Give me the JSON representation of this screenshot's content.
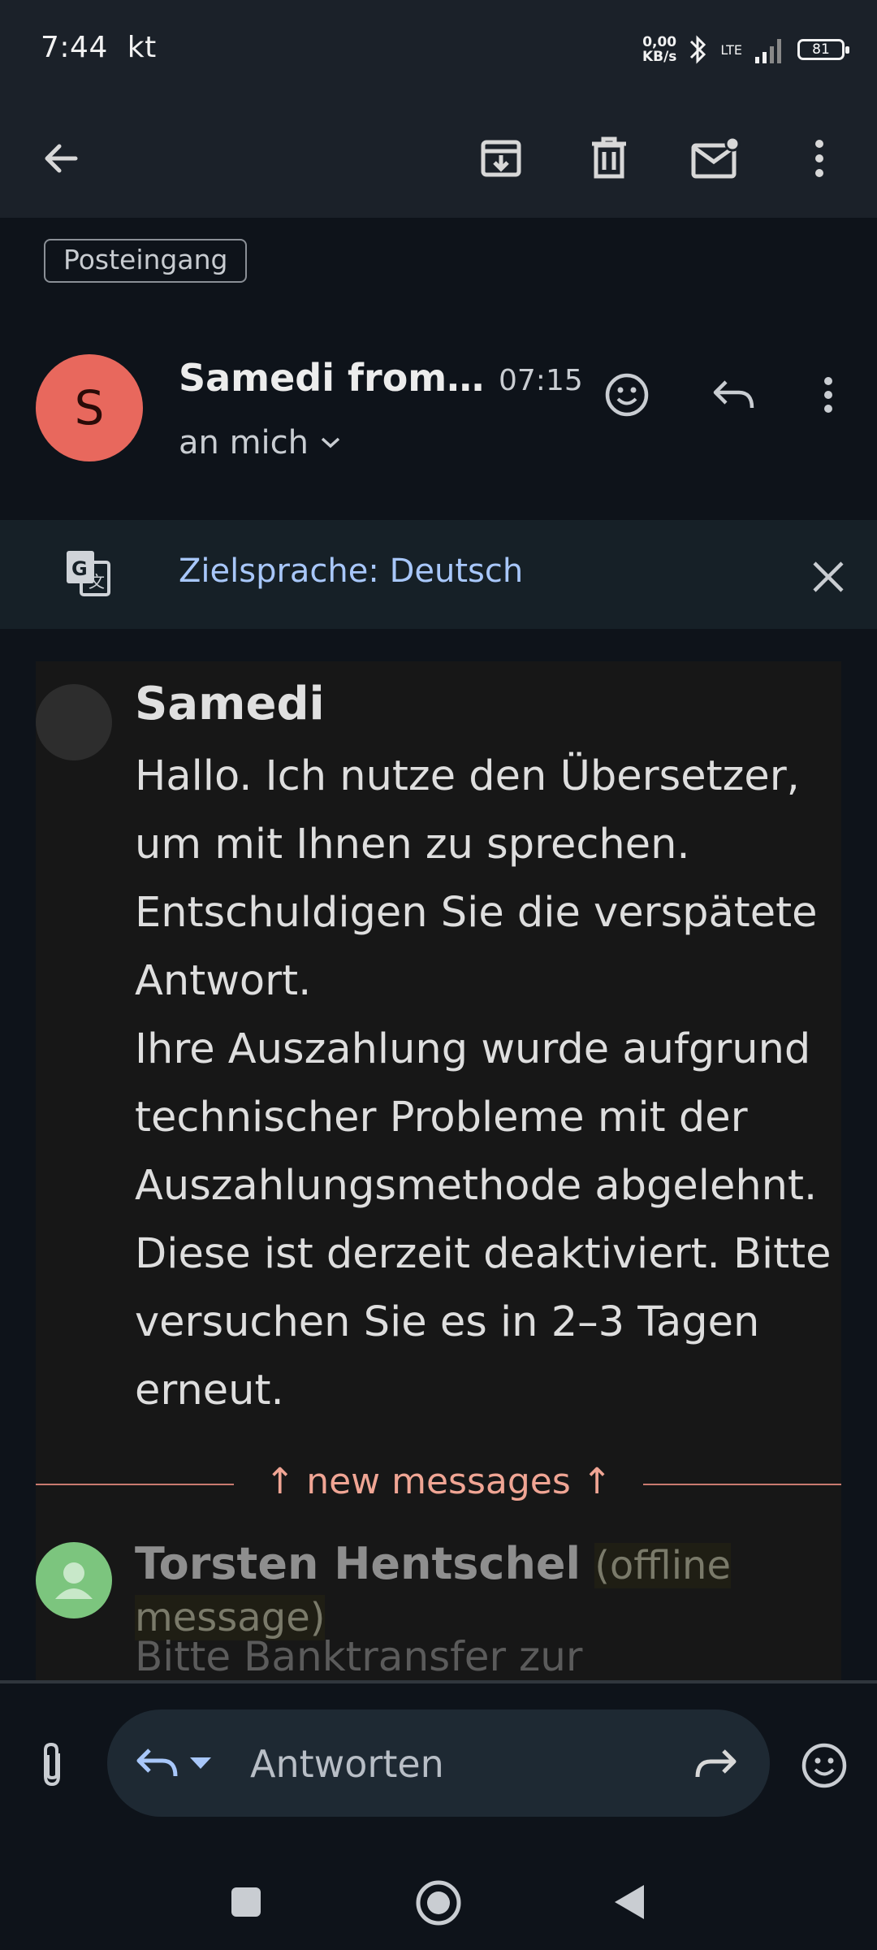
{
  "status_bar": {
    "time": "7:44",
    "carrier": "kt",
    "net_speed_value": "0,00",
    "net_speed_unit": "KB/s",
    "network": "LTE",
    "battery": "81"
  },
  "toolbar": {
    "icons": [
      "back-arrow-icon",
      "archive-icon",
      "delete-icon",
      "mark-unread-icon",
      "more-vert-icon"
    ]
  },
  "label": "Posteingang",
  "email": {
    "sender_initial": "S",
    "sender_name": "Samedi from…",
    "time": "07:15",
    "recipient": "an mich"
  },
  "translate_bar": {
    "text": "Zielsprache: Deutsch"
  },
  "message": {
    "sender": "Samedi",
    "body_lines": [
      "Hallo. Ich nutze den Übersetzer,",
      "um mit Ihnen zu sprechen.",
      "Entschuldigen Sie die verspätete",
      "Antwort.",
      "Ihre Auszahlung wurde aufgrund",
      "technischer Probleme mit der",
      "Auszahlungsmethode abgelehnt.",
      "Diese ist derzeit deaktiviert. Bitte",
      "versuchen Sie es in 2–3 Tagen",
      "erneut."
    ],
    "new_messages_label": "↑ new messages ↑",
    "second_sender": "Torsten Hentschel",
    "second_status": "(offline message)",
    "second_preview": "Bitte Banktransfer zur"
  },
  "compose": {
    "placeholder": "Antworten"
  },
  "colors": {
    "avatar": "#e8685d",
    "link": "#a8c7fa",
    "new_messages": "#f0a594",
    "background": "#0e131a"
  }
}
